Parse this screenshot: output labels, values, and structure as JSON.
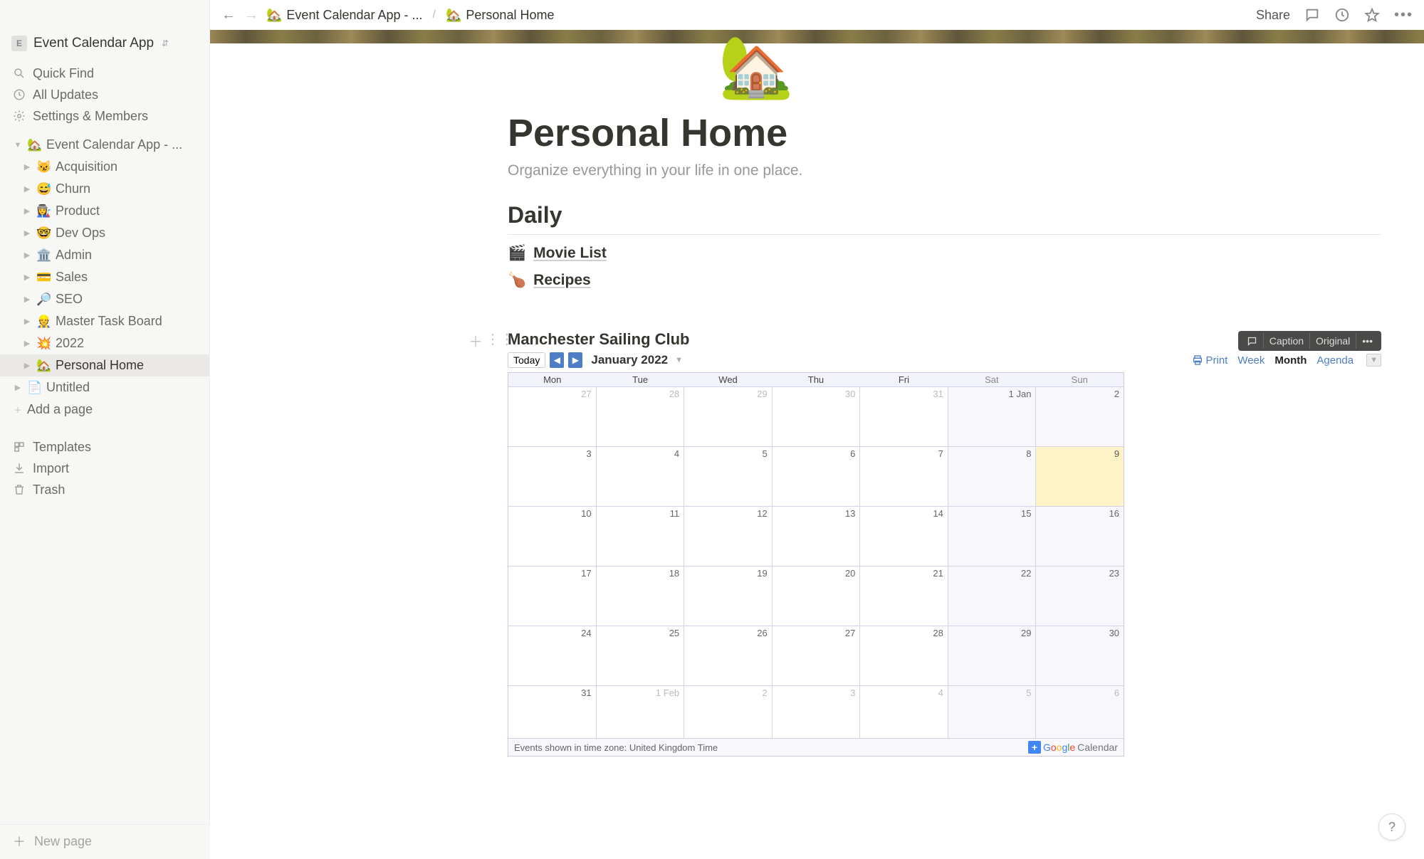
{
  "workspace": {
    "badge": "E",
    "name": "Event Calendar App"
  },
  "sidebar_top": {
    "quick_find": "Quick Find",
    "all_updates": "All Updates",
    "settings": "Settings & Members"
  },
  "tree": {
    "root": {
      "emoji": "🏡",
      "label": "Event Calendar App - ..."
    },
    "children": [
      {
        "emoji": "😼",
        "label": "Acquisition"
      },
      {
        "emoji": "😅",
        "label": "Churn"
      },
      {
        "emoji": "👩‍🏭",
        "label": "Product"
      },
      {
        "emoji": "🤓",
        "label": "Dev Ops"
      },
      {
        "emoji": "🏛️",
        "label": "Admin"
      },
      {
        "emoji": "💳",
        "label": "Sales"
      },
      {
        "emoji": "🔎",
        "label": "SEO"
      },
      {
        "emoji": "👷",
        "label": "Master Task Board"
      },
      {
        "emoji": "💥",
        "label": "2022"
      },
      {
        "emoji": "🏡",
        "label": "Personal Home"
      }
    ],
    "untitled": {
      "emoji": "📄",
      "label": "Untitled"
    },
    "add_page": "Add a page"
  },
  "sidebar_bottom": {
    "templates": "Templates",
    "import": "Import",
    "trash": "Trash"
  },
  "footer_new": "New page",
  "breadcrumb": {
    "back": "←",
    "fwd": "→",
    "root": {
      "emoji": "🏡",
      "label": "Event Calendar App - ..."
    },
    "sep": "/",
    "current": {
      "emoji": "🏡",
      "label": "Personal Home"
    }
  },
  "topright": {
    "share": "Share"
  },
  "page": {
    "emoji": "🏡",
    "title": "Personal Home",
    "subtitle": "Organize everything in your life in one place.",
    "section": "Daily",
    "links": [
      {
        "emoji": "🎬",
        "label": "Movie List"
      },
      {
        "emoji": "🍗",
        "label": "Recipes"
      }
    ]
  },
  "embed": {
    "float": {
      "caption": "Caption",
      "original": "Original"
    },
    "title": "Manchester Sailing Club",
    "today": "Today",
    "month_label": "January 2022",
    "print": "Print",
    "views": {
      "week": "Week",
      "month": "Month",
      "agenda": "Agenda"
    },
    "days": [
      "Mon",
      "Tue",
      "Wed",
      "Thu",
      "Fri",
      "Sat",
      "Sun"
    ],
    "rows": [
      [
        "27",
        "28",
        "29",
        "30",
        "31",
        "1 Jan",
        "2"
      ],
      [
        "3",
        "4",
        "5",
        "6",
        "7",
        "8",
        "9"
      ],
      [
        "10",
        "11",
        "12",
        "13",
        "14",
        "15",
        "16"
      ],
      [
        "17",
        "18",
        "19",
        "20",
        "21",
        "22",
        "23"
      ],
      [
        "24",
        "25",
        "26",
        "27",
        "28",
        "29",
        "30"
      ],
      [
        "31",
        "1 Feb",
        "2",
        "3",
        "4",
        "5",
        "6"
      ]
    ],
    "tz": "Events shown in time zone: United Kingdom Time",
    "gcal": "Calendar"
  }
}
